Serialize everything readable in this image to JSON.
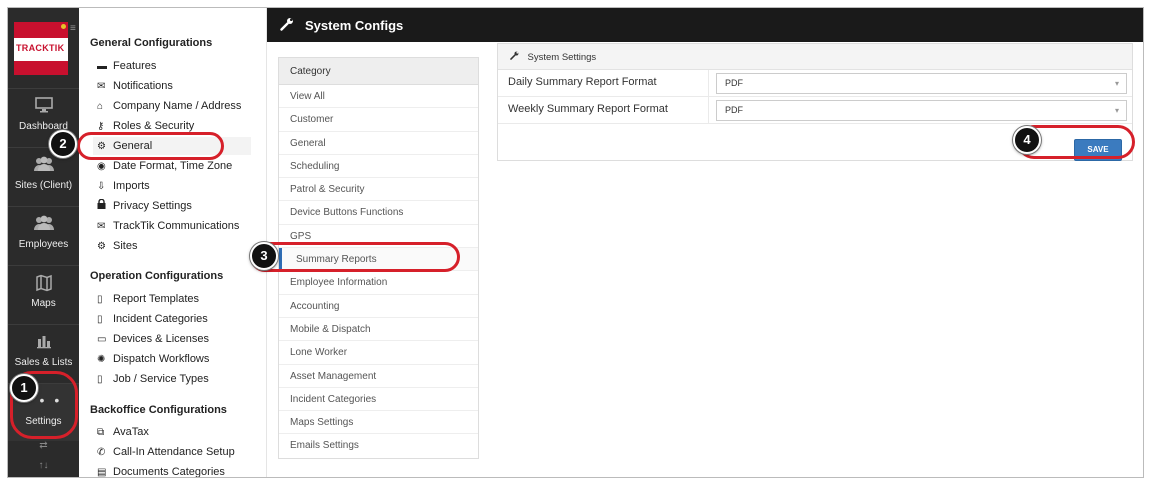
{
  "app": {
    "logo_text": "TRACKTIK",
    "header_title": "System Configs"
  },
  "rail": {
    "items": [
      {
        "label": "Dashboard",
        "icon": "monitor-icon"
      },
      {
        "label": "Sites (Client)",
        "icon": "people-icon"
      },
      {
        "label": "Employees",
        "icon": "people-icon"
      },
      {
        "label": "Maps",
        "icon": "map-icon"
      },
      {
        "label": "Sales & Lists",
        "icon": "bar-chart-icon"
      },
      {
        "label": "Settings",
        "icon": "gear-icon"
      }
    ],
    "bottom_icons": [
      "⇄",
      "↑↓"
    ]
  },
  "config_nav": {
    "general_heading": "General Configurations",
    "general_items": [
      {
        "label": "Features",
        "icon": "▬"
      },
      {
        "label": "Notifications",
        "icon": "✉"
      },
      {
        "label": "Company Name / Address",
        "icon": "⌂"
      },
      {
        "label": "Roles & Security",
        "icon": "⚷"
      },
      {
        "label": "General",
        "icon": "⚙"
      },
      {
        "label": "Date Format, Time Zone",
        "icon": "◉"
      },
      {
        "label": "Imports",
        "icon": "⇩"
      },
      {
        "label": "Privacy Settings",
        "icon": "🔒"
      },
      {
        "label": "TrackTik Communications",
        "icon": "✉"
      },
      {
        "label": "Sites",
        "icon": "⚙"
      }
    ],
    "operation_heading": "Operation Configurations",
    "operation_items": [
      {
        "label": "Report Templates",
        "icon": "▯"
      },
      {
        "label": "Incident Categories",
        "icon": "▯"
      },
      {
        "label": "Devices & Licenses",
        "icon": "▭"
      },
      {
        "label": "Dispatch Workflows",
        "icon": "✺"
      },
      {
        "label": "Job / Service Types",
        "icon": "▯"
      }
    ],
    "backoffice_heading": "Backoffice Configurations",
    "backoffice_items": [
      {
        "label": "AvaTax",
        "icon": "⧉"
      },
      {
        "label": "Call-In Attendance Setup",
        "icon": "✆"
      },
      {
        "label": "Documents Categories",
        "icon": "▤"
      }
    ]
  },
  "category": {
    "heading": "Category",
    "items": [
      "View All",
      "Customer",
      "General",
      "Scheduling",
      "Patrol & Security",
      "Device Buttons Functions",
      "GPS",
      "Summary Reports",
      "Employee Information",
      "Accounting",
      "Mobile & Dispatch",
      "Lone Worker",
      "Asset Management",
      "Incident Categories",
      "Maps Settings",
      "Emails Settings"
    ],
    "active": "Summary Reports"
  },
  "settings": {
    "panel_title": "System Settings",
    "rows": [
      {
        "label": "Daily Summary Report Format",
        "value": "PDF"
      },
      {
        "label": "Weekly Summary Report Format",
        "value": "PDF"
      }
    ],
    "save_label": "SAVE"
  },
  "callouts": [
    "1",
    "2",
    "3",
    "4"
  ],
  "colors": {
    "accent_red": "#d6202a",
    "save_blue": "#3b7bbf",
    "rail_bg": "#2b2b2b",
    "header_bg": "#1a1a1a"
  }
}
